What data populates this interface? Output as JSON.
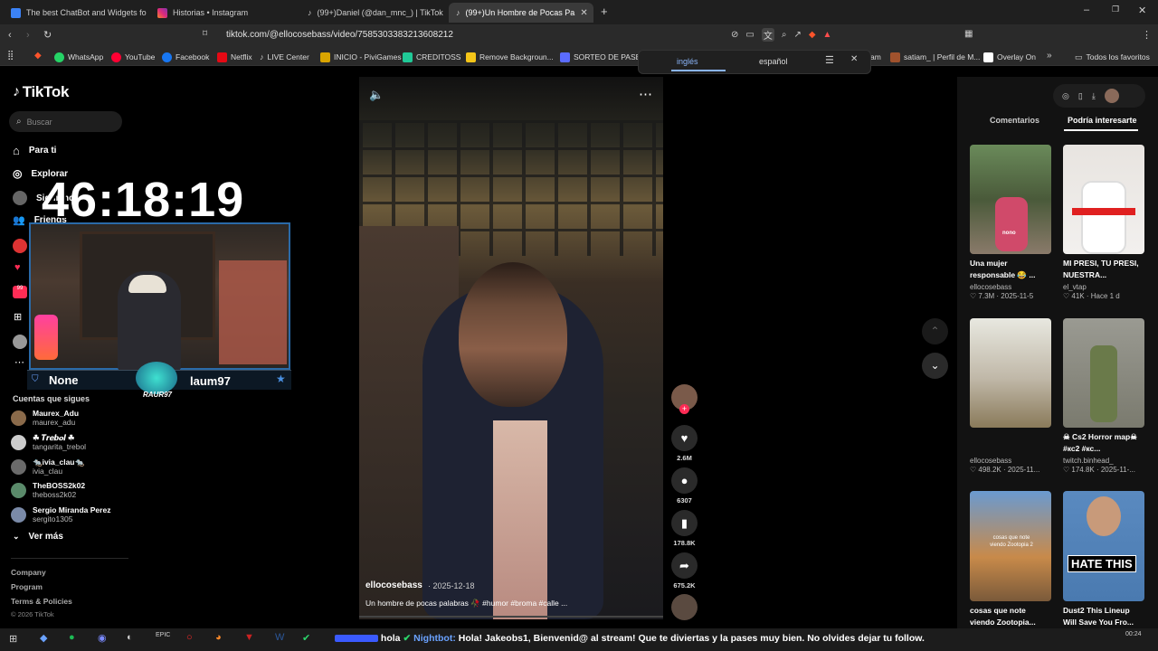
{
  "browser": {
    "tabs": [
      {
        "label": "The best ChatBot and Widgets for Ki",
        "icon": "bot-icon"
      },
      {
        "label": "Historias • Instagram",
        "icon": "instagram-icon"
      },
      {
        "label": "(99+)Daniel (@dan_mnc_) | TikTok",
        "icon": "tiktok-icon"
      },
      {
        "label": "(99+)Un Hombre de Pocas Pa",
        "icon": "tiktok-icon"
      }
    ],
    "url": "tiktok.com/@ellocosebass/video/7585303383213608212",
    "bookmarks": [
      "WhatsApp",
      "YouTube",
      "Facebook",
      "Netflix",
      "LIVE Center",
      "INICIO - PiviGames",
      "CREDITOSS",
      "Remove Backgroun...",
      "SORTEO DE PASE D..."
    ],
    "bookmarks_right": [
      "am",
      "satiam_ | Perfil de M...",
      "Overlay On",
      "Todos los favoritos"
    ]
  },
  "translate": {
    "lang_from": "inglés",
    "lang_to": "español"
  },
  "tiktok": {
    "logo": "TikTok",
    "search_placeholder": "Buscar",
    "nav": [
      "Para ti",
      "Explorar",
      "Siguiendo",
      "Friends"
    ],
    "following_title": "Cuentas que sigues",
    "following": [
      {
        "name": "Maurex_Adu",
        "handle": "maurex_adu"
      },
      {
        "name": "☘ 𝑻𝒓𝒆𝒃𝒐𝒍 ☘",
        "handle": "tangarita_trebol"
      },
      {
        "name": "🐀ivia_clau🐀",
        "handle": "ivia_clau"
      },
      {
        "name": "TheBOSS2k02",
        "handle": "theboss2k02"
      },
      {
        "name": "Sergio Miranda Perez",
        "handle": "sergito1305"
      }
    ],
    "see_more": "Ver más",
    "footer": [
      "Company",
      "Program",
      "Terms & Policies",
      "© 2026 TikTok"
    ]
  },
  "overlay": {
    "timer": "46:18:19",
    "left_name": "None",
    "right_name": "laum97",
    "logo_text": "RAUR97"
  },
  "video": {
    "author": "ellocosebass",
    "date": "· 2025-12-18",
    "caption": "Un hombre de pocas palabras 🥀 #humor #broma #calle ...",
    "likes": "2.6M",
    "comments": "6307",
    "saves": "178.8K",
    "shares": "675.2K"
  },
  "right_panel": {
    "tab_comments": "Comentarios",
    "tab_interest": "Podría interesarte",
    "cards": [
      {
        "title": "Una mujer responsable 😂 ...",
        "user": "ellocosebass",
        "stats": "♡ 7.3M · 2025-11-5",
        "thumb_label": "nono"
      },
      {
        "title": "MI PRESI, TU PRESI, NUESTRA...",
        "user": "el_vtap",
        "stats": "♡ 41K · Hace 1 d",
        "thumb_label": ""
      },
      {
        "title": "",
        "user": "ellocosebass",
        "stats": "♡ 498.2K · 2025-11...",
        "thumb_label": ""
      },
      {
        "title": "☠ Cs2 Horror map☠ #кс2 #кс...",
        "user": "twitch.binhead_",
        "stats": "♡ 174.8K · 2025-11-...",
        "thumb_label": ""
      },
      {
        "title": "cosas que note viendo Zootopia...",
        "user": "",
        "stats": "",
        "thumb_label": "cosas que note viendo Zootopia 2"
      },
      {
        "title": "Dust2 This Lineup Will Save You Fro...",
        "user": "",
        "stats": "",
        "thumb_label": "HATE THIS"
      }
    ]
  },
  "ticker": {
    "prefix": "hola",
    "bot": "Nightbot:",
    "message": "Hola! Jakeobs1, Bienvenid@ al stream! Que te diviertas y la pases muy bien. No olvides dejar tu follow."
  },
  "colors": {
    "accent": "#fe2c55",
    "link": "#6aa2ff",
    "overlay_blue": "#2a6aa8"
  }
}
